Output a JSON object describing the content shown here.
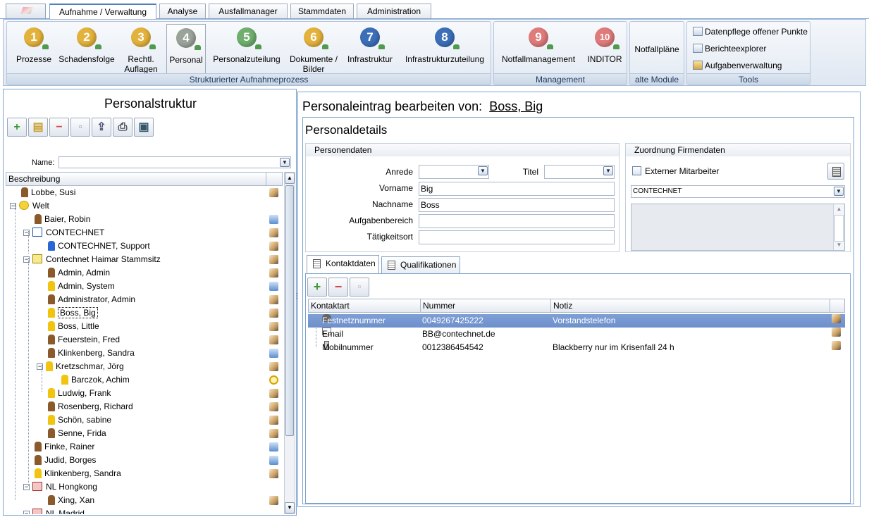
{
  "top_tabs": [
    "Aufnahme / Verwaltung",
    "Analyse",
    "Ausfallmanager",
    "Stammdaten",
    "Administration"
  ],
  "ribbon": {
    "process_group": {
      "label": "Strukturierter Aufnahmeprozess",
      "buttons": [
        {
          "num": "1",
          "label": "Prozesse",
          "color": "#e3b23c"
        },
        {
          "num": "2",
          "label": "Schadensfolge",
          "color": "#e3b23c"
        },
        {
          "num": "3",
          "label": "Rechtl. Auflagen",
          "color": "#e3b23c"
        },
        {
          "num": "4",
          "label": "Personal",
          "color": "#9aa39a"
        },
        {
          "num": "5",
          "label": "Personalzuteilung",
          "color": "#6fae6d"
        },
        {
          "num": "6",
          "label": "Dokumente / Bilder",
          "color": "#e3b23c"
        },
        {
          "num": "7",
          "label": "Infrastruktur",
          "color": "#3c6fb8"
        },
        {
          "num": "8",
          "label": "Infrastrukturzuteilung",
          "color": "#3c6fb8"
        }
      ]
    },
    "management_group": {
      "label": "Management",
      "buttons": [
        {
          "num": "9",
          "label": "Notfallmanagement",
          "color": "#df7b7b"
        },
        {
          "num": "10",
          "label": "INDITOR",
          "color": "#df7b7b"
        }
      ]
    },
    "alte_group": {
      "label": "alte Module",
      "button": "Notfallpläne"
    },
    "tools_group": {
      "label": "Tools",
      "items": [
        "Datenpflege offener Punkte",
        "Berichteexplorer",
        "Aufgabenverwaltung"
      ]
    }
  },
  "left": {
    "title": "Personalstruktur",
    "name_label": "Name:",
    "column_header": "Beschreibung",
    "tree": [
      {
        "label": "Lobbe, Susi",
        "level": 0,
        "icon": "person-brown",
        "right": "edit"
      },
      {
        "label": "Welt",
        "level": 0,
        "icon": "world",
        "expander": "−",
        "right": ""
      },
      {
        "label": "Baier, Robin",
        "level": 1,
        "icon": "person-brown",
        "right": "list"
      },
      {
        "label": "CONTECHNET",
        "level": 1,
        "icon": "org-blue",
        "expander": "−",
        "right": "edit"
      },
      {
        "label": "CONTECHNET, Support",
        "level": 2,
        "icon": "person-blue",
        "right": "edit"
      },
      {
        "label": "Contechnet Haimar Stammsitz",
        "level": 1,
        "icon": "org-yellow",
        "expander": "−",
        "right": "edit"
      },
      {
        "label": "Admin, Admin",
        "level": 2,
        "icon": "person-brown",
        "right": "edit"
      },
      {
        "label": "Admin, System",
        "level": 2,
        "icon": "person-yellow",
        "right": "list"
      },
      {
        "label": "Administrator, Admin",
        "level": 2,
        "icon": "person-brown",
        "right": "edit"
      },
      {
        "label": "Boss, Big",
        "level": 2,
        "icon": "person-yellow",
        "right": "edit",
        "selected": true
      },
      {
        "label": "Boss, Little",
        "level": 2,
        "icon": "person-yellow",
        "right": "edit"
      },
      {
        "label": "Feuerstein, Fred",
        "level": 2,
        "icon": "person-brown",
        "right": "edit"
      },
      {
        "label": "Klinkenberg, Sandra",
        "level": 2,
        "icon": "person-brown",
        "right": "list"
      },
      {
        "label": "Kretzschmar, Jörg",
        "level": 2,
        "icon": "person-yellow",
        "expander": "−",
        "right": "edit"
      },
      {
        "label": "Barczok, Achim",
        "level": 3,
        "icon": "person-yellow",
        "right": "circle"
      },
      {
        "label": "Ludwig, Frank",
        "level": 2,
        "icon": "person-yellow",
        "right": "edit"
      },
      {
        "label": "Rosenberg, Richard",
        "level": 2,
        "icon": "person-brown",
        "right": "edit"
      },
      {
        "label": "Schön, sabine",
        "level": 2,
        "icon": "person-yellow",
        "right": "edit"
      },
      {
        "label": "Senne, Frida",
        "level": 2,
        "icon": "person-brown",
        "right": "edit"
      },
      {
        "label": "Finke, Rainer",
        "level": 1,
        "icon": "person-brown",
        "right": "list"
      },
      {
        "label": "Judid, Borges",
        "level": 1,
        "icon": "person-brown",
        "right": "list"
      },
      {
        "label": "Klinkenberg, Sandra",
        "level": 1,
        "icon": "person-yellow",
        "right": "edit"
      },
      {
        "label": "NL Hongkong",
        "level": 1,
        "icon": "org-red",
        "expander": "−",
        "right": ""
      },
      {
        "label": "Xing, Xan",
        "level": 2,
        "icon": "person-brown",
        "right": "edit"
      },
      {
        "label": "NL Madrid",
        "level": 1,
        "icon": "org-red",
        "expander": "−",
        "right": ""
      }
    ]
  },
  "right": {
    "heading_prefix": "Personaleintrag bearbeiten von:",
    "heading_name": "Boss, Big",
    "details_title": "Personaldetails",
    "personendaten": {
      "legend": "Personendaten",
      "anrede_label": "Anrede",
      "titel_label": "Titel",
      "vorname_label": "Vorname",
      "vorname": "Big",
      "nachname_label": "Nachname",
      "nachname": "Boss",
      "aufgabenbereich_label": "Aufgabenbereich",
      "aufgabenbereich": "",
      "taetigkeitsort_label": "Tätigkeitsort",
      "taetigkeitsort": ""
    },
    "firmendaten": {
      "legend": "Zuordnung Firmendaten",
      "extern_label": "Externer Mitarbeiter",
      "firma": "CONTECHNET"
    },
    "tabs": [
      "Kontaktdaten",
      "Qualifikationen"
    ],
    "grid": {
      "columns": [
        "Kontaktart",
        "Nummer",
        "Notiz"
      ],
      "rows": [
        {
          "art": "Festnetznummer",
          "nummer": "0049267425222",
          "notiz": "Vorstandstelefon",
          "icon": "phone",
          "selected": true
        },
        {
          "art": "Email",
          "nummer": "BB@contechnet.de",
          "notiz": "",
          "icon": "mail"
        },
        {
          "art": "Mobilnummer",
          "nummer": "0012386454542",
          "notiz": "Blackberry nur im Krisenfall 24 h",
          "icon": "mobile"
        }
      ]
    }
  }
}
